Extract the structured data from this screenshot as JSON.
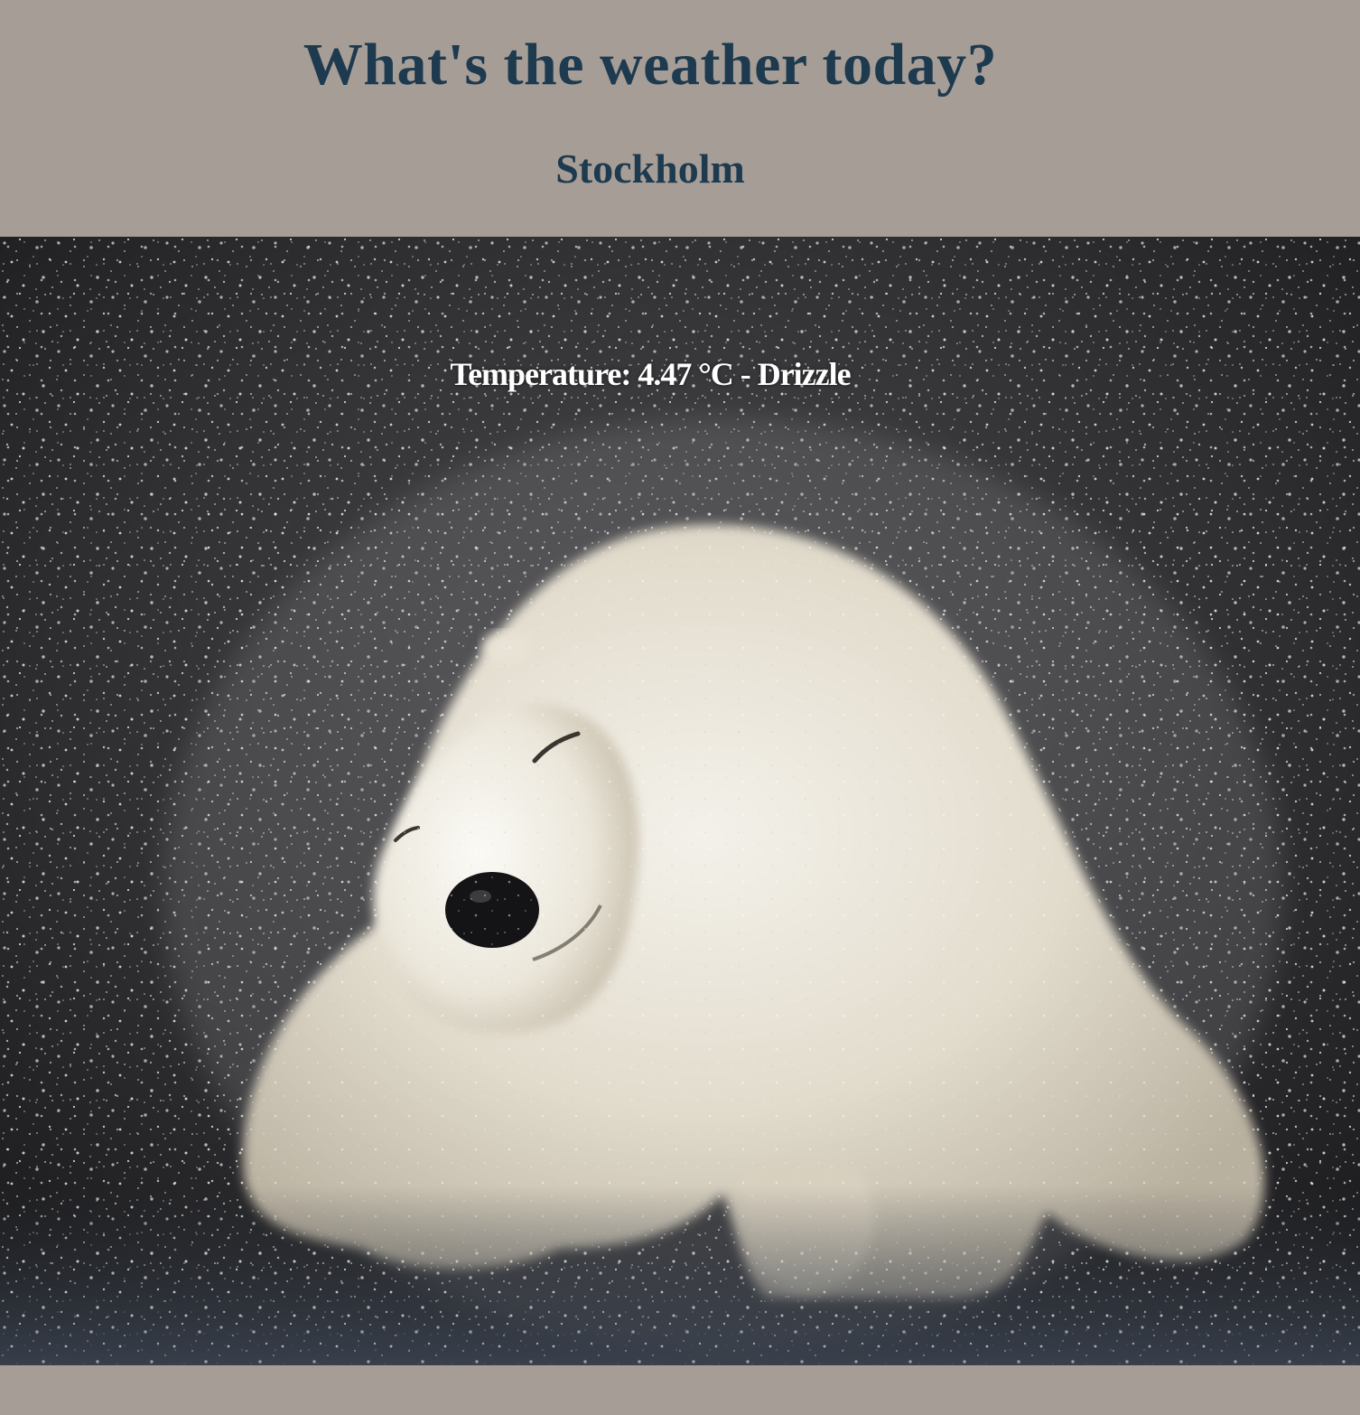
{
  "header": {
    "title": "What's the weather today?",
    "city": "Stockholm"
  },
  "weather": {
    "summary": "Temperature: 4.47 °C - Drizzle"
  },
  "background_image": {
    "icon": "polar-bear-shaking-water-photo"
  },
  "colors": {
    "page_background": "#a69d97",
    "heading_text": "#1d3a4f",
    "overlay_text": "#ffffff"
  }
}
